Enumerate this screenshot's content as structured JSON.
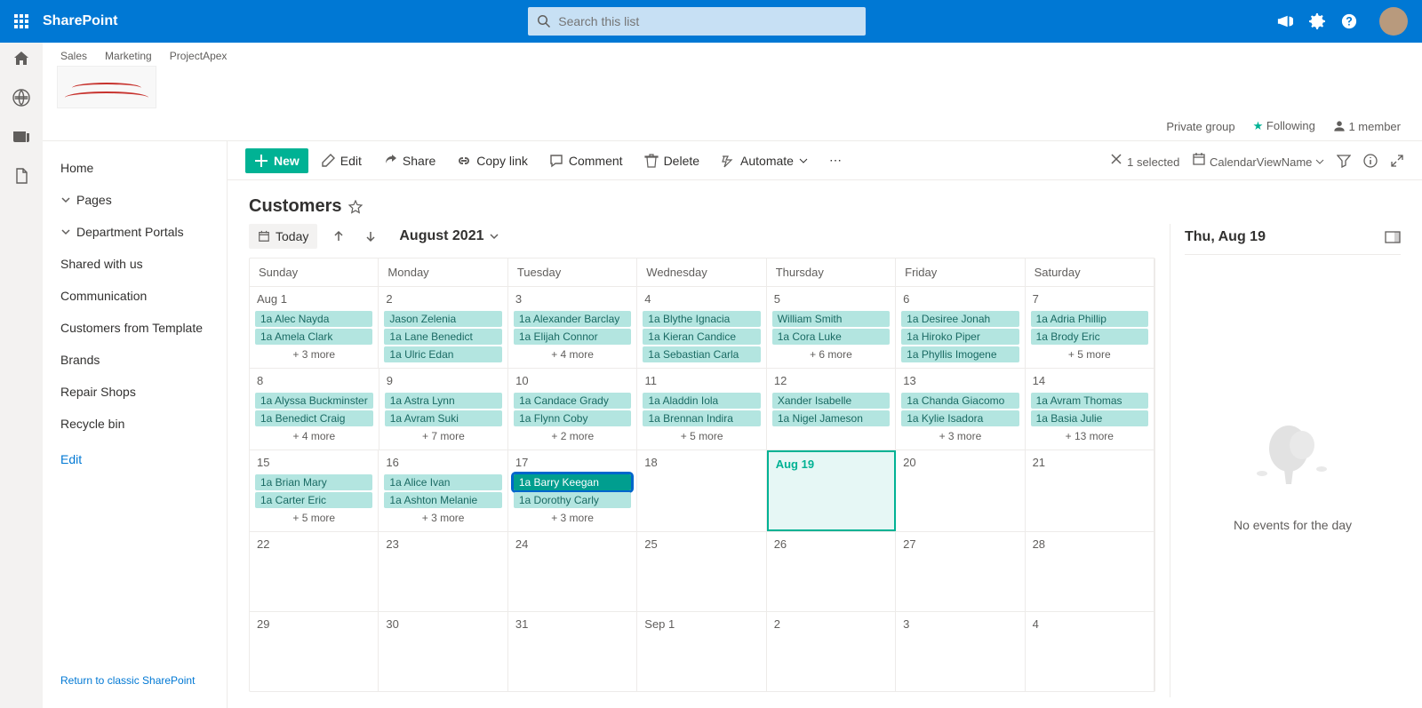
{
  "suite": {
    "app_name": "SharePoint",
    "search_placeholder": "Search this list"
  },
  "breadcrumbs": [
    "Sales",
    "Marketing",
    "ProjectApex"
  ],
  "site_meta": {
    "privacy": "Private group",
    "following": "Following",
    "members": "1 member"
  },
  "left_nav": {
    "items": [
      "Home",
      "Pages",
      "Department Portals",
      "Shared with us",
      "Communication",
      "Customers from Template",
      "Brands",
      "Repair Shops",
      "Recycle bin"
    ],
    "edit": "Edit",
    "classic": "Return to classic SharePoint"
  },
  "cmd": {
    "new": "New",
    "edit": "Edit",
    "share": "Share",
    "copy": "Copy link",
    "comment": "Comment",
    "delete": "Delete",
    "automate": "Automate",
    "selected": "1 selected",
    "view": "CalendarViewName"
  },
  "list_title": "Customers",
  "calendar": {
    "today": "Today",
    "month": "August 2021",
    "dow": [
      "Sunday",
      "Monday",
      "Tuesday",
      "Wednesday",
      "Thursday",
      "Friday",
      "Saturday"
    ],
    "rows": [
      [
        {
          "num": "Aug 1",
          "events": [
            {
              "p": "1a",
              "t": "Alec Nayda"
            },
            {
              "p": "1a",
              "t": "Amela Clark"
            }
          ],
          "more": "+ 3 more"
        },
        {
          "num": "2",
          "events": [
            {
              "p": "",
              "t": "Jason Zelenia"
            },
            {
              "p": "1a",
              "t": "Lane Benedict"
            },
            {
              "p": "1a",
              "t": "Ulric Edan"
            }
          ]
        },
        {
          "num": "3",
          "events": [
            {
              "p": "1a",
              "t": "Alexander Barclay"
            },
            {
              "p": "1a",
              "t": "Elijah Connor"
            }
          ],
          "more": "+ 4 more"
        },
        {
          "num": "4",
          "events": [
            {
              "p": "1a",
              "t": "Blythe Ignacia"
            },
            {
              "p": "1a",
              "t": "Kieran Candice"
            },
            {
              "p": "1a",
              "t": "Sebastian Carla"
            }
          ]
        },
        {
          "num": "5",
          "events": [
            {
              "p": "",
              "t": "William Smith"
            },
            {
              "p": "1a",
              "t": "Cora Luke"
            }
          ],
          "more": "+ 6 more"
        },
        {
          "num": "6",
          "events": [
            {
              "p": "1a",
              "t": "Desiree Jonah"
            },
            {
              "p": "1a",
              "t": "Hiroko Piper"
            },
            {
              "p": "1a",
              "t": "Phyllis Imogene"
            }
          ]
        },
        {
          "num": "7",
          "events": [
            {
              "p": "1a",
              "t": "Adria Phillip"
            },
            {
              "p": "1a",
              "t": "Brody Eric"
            }
          ],
          "more": "+ 5 more"
        }
      ],
      [
        {
          "num": "8",
          "events": [
            {
              "p": "1a",
              "t": "Alyssa Buckminster"
            },
            {
              "p": "1a",
              "t": "Benedict Craig"
            }
          ],
          "more": "+ 4 more"
        },
        {
          "num": "9",
          "events": [
            {
              "p": "1a",
              "t": "Astra Lynn"
            },
            {
              "p": "1a",
              "t": "Avram Suki"
            }
          ],
          "more": "+ 7 more"
        },
        {
          "num": "10",
          "events": [
            {
              "p": "1a",
              "t": "Candace Grady"
            },
            {
              "p": "1a",
              "t": "Flynn Coby"
            }
          ],
          "more": "+ 2 more"
        },
        {
          "num": "11",
          "events": [
            {
              "p": "1a",
              "t": "Aladdin Iola"
            },
            {
              "p": "1a",
              "t": "Brennan Indira"
            }
          ],
          "more": "+ 5 more"
        },
        {
          "num": "12",
          "events": [
            {
              "p": "",
              "t": "Xander Isabelle"
            },
            {
              "p": "1a",
              "t": "Nigel Jameson"
            }
          ]
        },
        {
          "num": "13",
          "events": [
            {
              "p": "1a",
              "t": "Chanda Giacomo"
            },
            {
              "p": "1a",
              "t": "Kylie Isadora"
            }
          ],
          "more": "+ 3 more"
        },
        {
          "num": "14",
          "events": [
            {
              "p": "1a",
              "t": "Avram Thomas"
            },
            {
              "p": "1a",
              "t": "Basia Julie"
            }
          ],
          "more": "+ 13 more"
        }
      ],
      [
        {
          "num": "15",
          "events": [
            {
              "p": "1a",
              "t": "Brian Mary"
            },
            {
              "p": "1a",
              "t": "Carter Eric"
            }
          ],
          "more": "+ 5 more"
        },
        {
          "num": "16",
          "events": [
            {
              "p": "1a",
              "t": "Alice Ivan"
            },
            {
              "p": "1a",
              "t": "Ashton Melanie"
            }
          ],
          "more": "+ 3 more"
        },
        {
          "num": "17",
          "events": [
            {
              "p": "1a",
              "t": "Barry Keegan",
              "sel": true
            },
            {
              "p": "1a",
              "t": "Dorothy Carly"
            }
          ],
          "more": "+ 3 more"
        },
        {
          "num": "18",
          "events": []
        },
        {
          "num": "Aug 19",
          "events": [],
          "today": true
        },
        {
          "num": "20",
          "events": []
        },
        {
          "num": "21",
          "events": []
        }
      ],
      [
        {
          "num": "22",
          "events": []
        },
        {
          "num": "23",
          "events": []
        },
        {
          "num": "24",
          "events": []
        },
        {
          "num": "25",
          "events": []
        },
        {
          "num": "26",
          "events": []
        },
        {
          "num": "27",
          "events": []
        },
        {
          "num": "28",
          "events": []
        }
      ],
      [
        {
          "num": "29",
          "events": []
        },
        {
          "num": "30",
          "events": []
        },
        {
          "num": "31",
          "events": []
        },
        {
          "num": "Sep 1",
          "events": []
        },
        {
          "num": "2",
          "events": []
        },
        {
          "num": "3",
          "events": []
        },
        {
          "num": "4",
          "events": []
        }
      ]
    ]
  },
  "detail": {
    "title": "Thu, Aug 19",
    "empty": "No events for the day"
  }
}
